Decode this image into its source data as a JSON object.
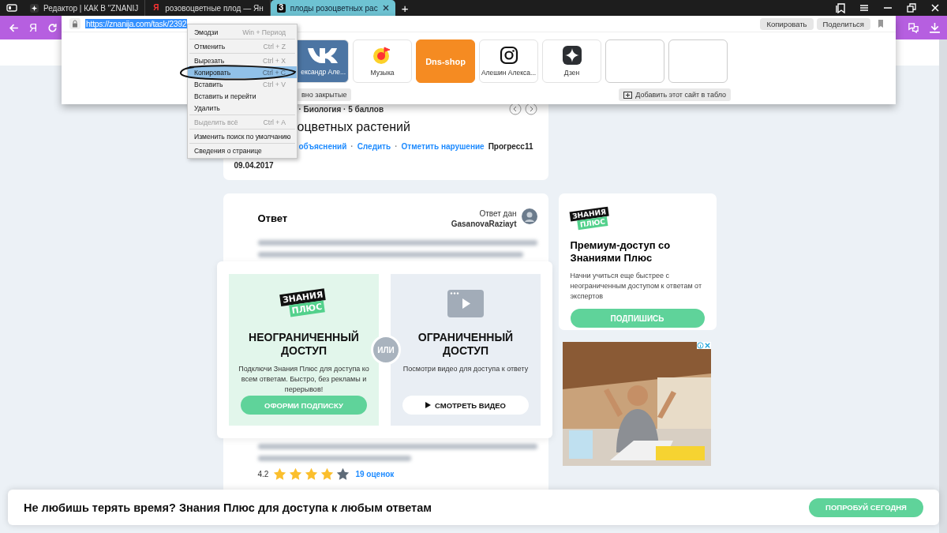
{
  "tabs": [
    {
      "kind": "editor",
      "title": "Редактор | КАК В \"ZNANIJ",
      "selected": false
    },
    {
      "kind": "yandex",
      "icon_text": "Я",
      "title": "розовоцветные плод — Ян",
      "selected": false
    },
    {
      "kind": "site",
      "icon_text": "З",
      "title": "плоды розоцветных рас",
      "selected": true
    }
  ],
  "new_tab": "+",
  "toolbar": {
    "home": "Я"
  },
  "address": {
    "url": "https://znanija.com/task/2392",
    "selected": true,
    "buttons": [
      "Копировать",
      "Поделиться"
    ]
  },
  "tiles": [
    {
      "kind": "vk",
      "label": "ександр Але..."
    },
    {
      "kind": "music",
      "label": "Музыка"
    },
    {
      "kind": "dns",
      "label": "Dns-shop"
    },
    {
      "kind": "instagram",
      "label": "Алешин Алекса..."
    },
    {
      "kind": "zen",
      "label": "Дзен"
    },
    {
      "kind": "empty"
    },
    {
      "kind": "empty"
    }
  ],
  "recent_button": "вно закрытые",
  "add_button": "Добавить этот сайт в табло",
  "context_menu": {
    "groups": [
      {
        "items": [
          {
            "label": "Эмодзи",
            "shortcut": "Win + Период",
            "selected": false,
            "disabled": false
          }
        ]
      },
      {
        "items": [
          {
            "label": "Отменить",
            "shortcut": "Ctrl + Z",
            "selected": false,
            "disabled": false
          }
        ]
      },
      {
        "items": [
          {
            "label": "Вырезать",
            "shortcut": "Ctrl + X",
            "selected": false,
            "disabled": false
          },
          {
            "label": "Копировать",
            "shortcut": "Ctrl + C",
            "selected": true,
            "disabled": false
          },
          {
            "label": "Вставить",
            "shortcut": "Ctrl + V",
            "selected": false,
            "disabled": false
          },
          {
            "label": "Вставить и перейти",
            "selected": false,
            "disabled": false
          },
          {
            "label": "Удалить",
            "selected": false,
            "disabled": false
          }
        ]
      },
      {
        "items": [
          {
            "label": "Выделить всё",
            "shortcut": "Ctrl + A",
            "selected": false,
            "disabled": true
          }
        ]
      },
      {
        "items": [
          {
            "label": "Изменить поиск по умолчанию",
            "selected": false,
            "disabled": false
          }
        ]
      },
      {
        "items": [
          {
            "label": "Сведения о странице",
            "selected": false,
            "disabled": false
          }
        ]
      }
    ]
  },
  "question": {
    "meta": "· Биология · 5 баллов",
    "title": "оцветных растений",
    "links": [
      "объяснений",
      "Следить",
      "Отметить нарушение"
    ],
    "separator": "·",
    "author": "Прогресс11",
    "date": "09.04.2017"
  },
  "answer": {
    "heading": "Ответ",
    "by_label": "Ответ дан",
    "author": "GasanovaRaziayt",
    "rating": "4.2",
    "stars": 4,
    "votes": "19 оценок"
  },
  "paywall": {
    "divider": "ИЛИ",
    "options": [
      {
        "kind": "subscribe",
        "logo": [
          "ЗНАНИЯ",
          "ПЛЮС"
        ],
        "title": "НЕОГРАНИЧЕННЫЙ ДОСТУП",
        "text": "Подключи Знания Плюс для доступа ко всем ответам. Быстро, без рекламы и перерывов!",
        "button": "ОФОРМИ ПОДПИСКУ"
      },
      {
        "kind": "video",
        "title": "ОГРАНИЧЕННЫЙ ДОСТУП",
        "text": "Посмотри видео для доступа к ответу",
        "button": "СМОТРЕТЬ ВИДЕО"
      }
    ]
  },
  "premium": {
    "logo": [
      "ЗНАНИЯ",
      "ПЛЮС"
    ],
    "title": "Премиум-доступ со Знаниями Плюс",
    "text": "Начни учиться еще быстрее с неограниченным доступом к ответам от экспертов",
    "button": "ПОДПИШИСЬ"
  },
  "banner": {
    "text": "Не любишь терять время? Знания Плюс для доступа к любым ответам",
    "button": "ПОПРОБУЙ СЕГОДНЯ"
  }
}
